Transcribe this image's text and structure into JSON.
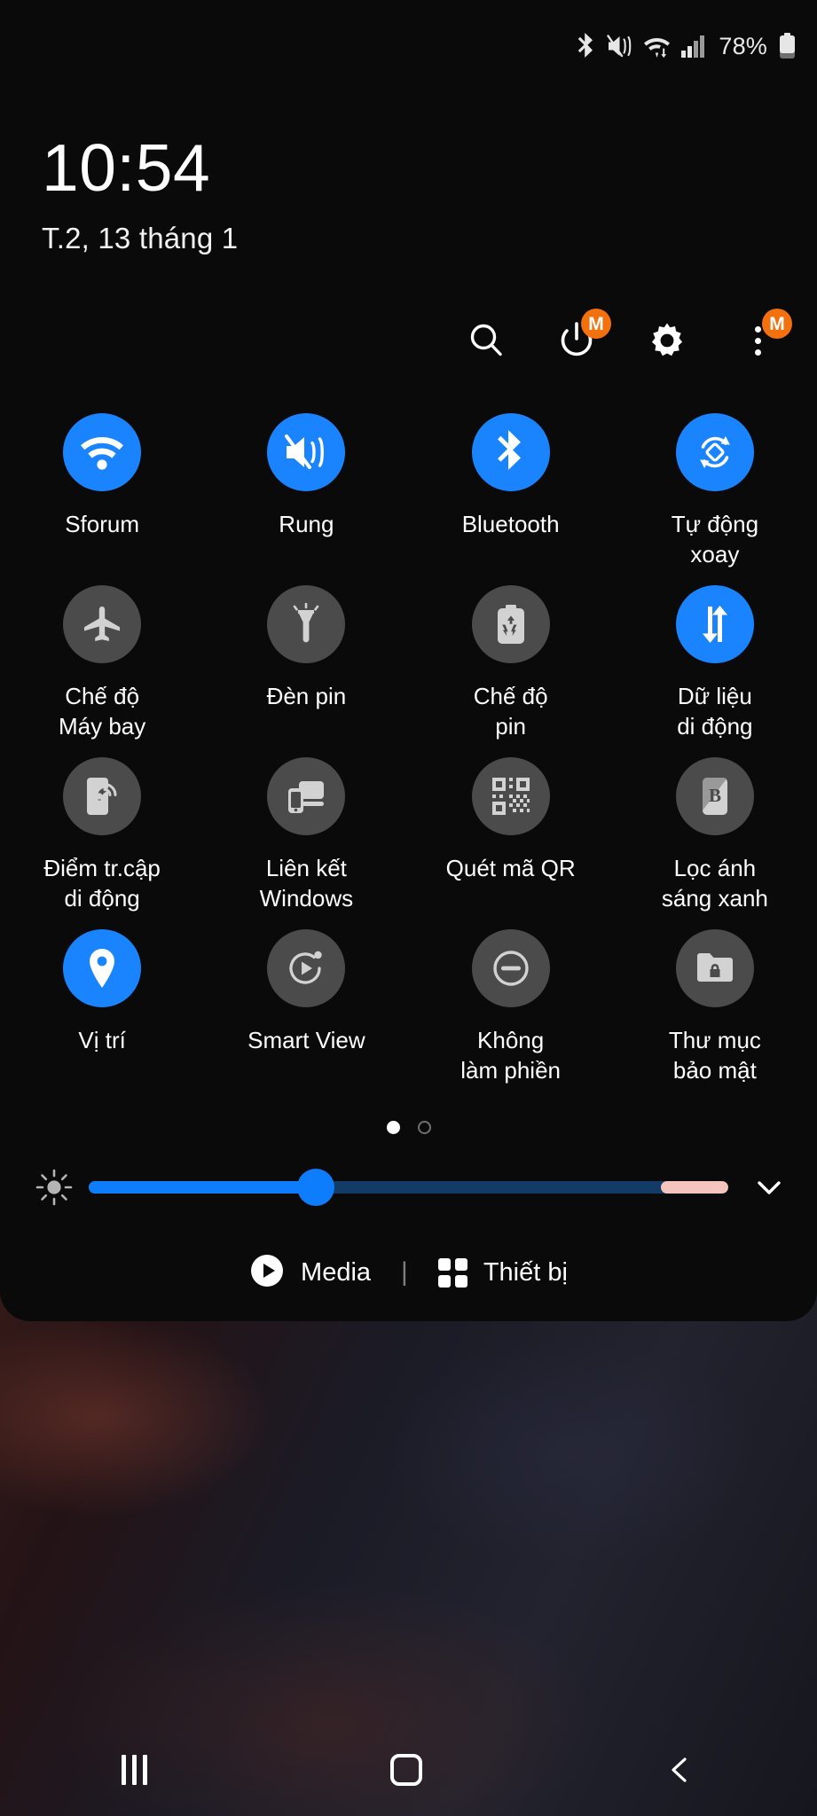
{
  "statusbar": {
    "icons": [
      "bluetooth-icon",
      "vibrate-mute-icon",
      "wifi-data-icon",
      "signal-bars-icon"
    ],
    "battery_percent": "78%",
    "battery_icon": "battery-icon"
  },
  "clock": {
    "time": "10:54",
    "date": "T.2, 13 tháng 1"
  },
  "header_actions": [
    {
      "name": "search-button",
      "icon": "search-icon",
      "badge": ""
    },
    {
      "name": "power-button",
      "icon": "power-icon",
      "badge": "M"
    },
    {
      "name": "settings-button",
      "icon": "gear-icon",
      "badge": ""
    },
    {
      "name": "more-options-button",
      "icon": "three-dots-icon",
      "badge": "M"
    }
  ],
  "tiles": [
    {
      "label": "Sforum",
      "icon": "wifi-icon",
      "active": true
    },
    {
      "label": "Rung",
      "icon": "vibrate-icon",
      "active": true
    },
    {
      "label": "Bluetooth",
      "icon": "bluetooth-icon",
      "active": true
    },
    {
      "label": "Tự động\nxoay",
      "icon": "auto-rotate-icon",
      "active": true
    },
    {
      "label": "Chế độ\nMáy bay",
      "icon": "airplane-icon",
      "active": false
    },
    {
      "label": "Đèn pin",
      "icon": "flashlight-icon",
      "active": false
    },
    {
      "label": "Chế độ\npin",
      "icon": "battery-saver-icon",
      "active": false
    },
    {
      "label": "Dữ liệu\ndi động",
      "icon": "mobile-data-icon",
      "active": true
    },
    {
      "label": "Điểm tr.cập\ndi động",
      "icon": "hotspot-icon",
      "active": false
    },
    {
      "label": "Liên kết\nWindows",
      "icon": "link-windows-icon",
      "active": false
    },
    {
      "label": "Quét mã QR",
      "icon": "qr-code-icon",
      "active": false
    },
    {
      "label": "Lọc ánh\nsáng xanh",
      "icon": "blue-light-icon",
      "active": false
    },
    {
      "label": "Vị trí",
      "icon": "location-pin-icon",
      "active": true
    },
    {
      "label": "Smart View",
      "icon": "smart-view-icon",
      "active": false
    },
    {
      "label": "Không\nlàm phiền",
      "icon": "do-not-disturb-icon",
      "active": false
    },
    {
      "label": "Thư mục\nbảo mật",
      "icon": "secure-folder-icon",
      "active": false
    }
  ],
  "pager": {
    "pages": 2,
    "current": 1
  },
  "brightness": {
    "icon": "brightness-icon",
    "value_percent": 35,
    "expand_icon": "chevron-down-icon"
  },
  "footer": {
    "media_label": "Media",
    "media_icon": "play-circle-icon",
    "separator": "|",
    "devices_label": "Thiết bị",
    "devices_icon": "grid-squares-icon"
  },
  "navbar": {
    "recents": "recents-icon",
    "home": "home-icon",
    "back": "back-icon"
  },
  "colors": {
    "accent": "#1a84ff",
    "badge": "#f3700f",
    "tile_off": "#4b4b4b",
    "panel_bg": "#0a0a0a",
    "slider_tail": "#f5c4bd"
  }
}
